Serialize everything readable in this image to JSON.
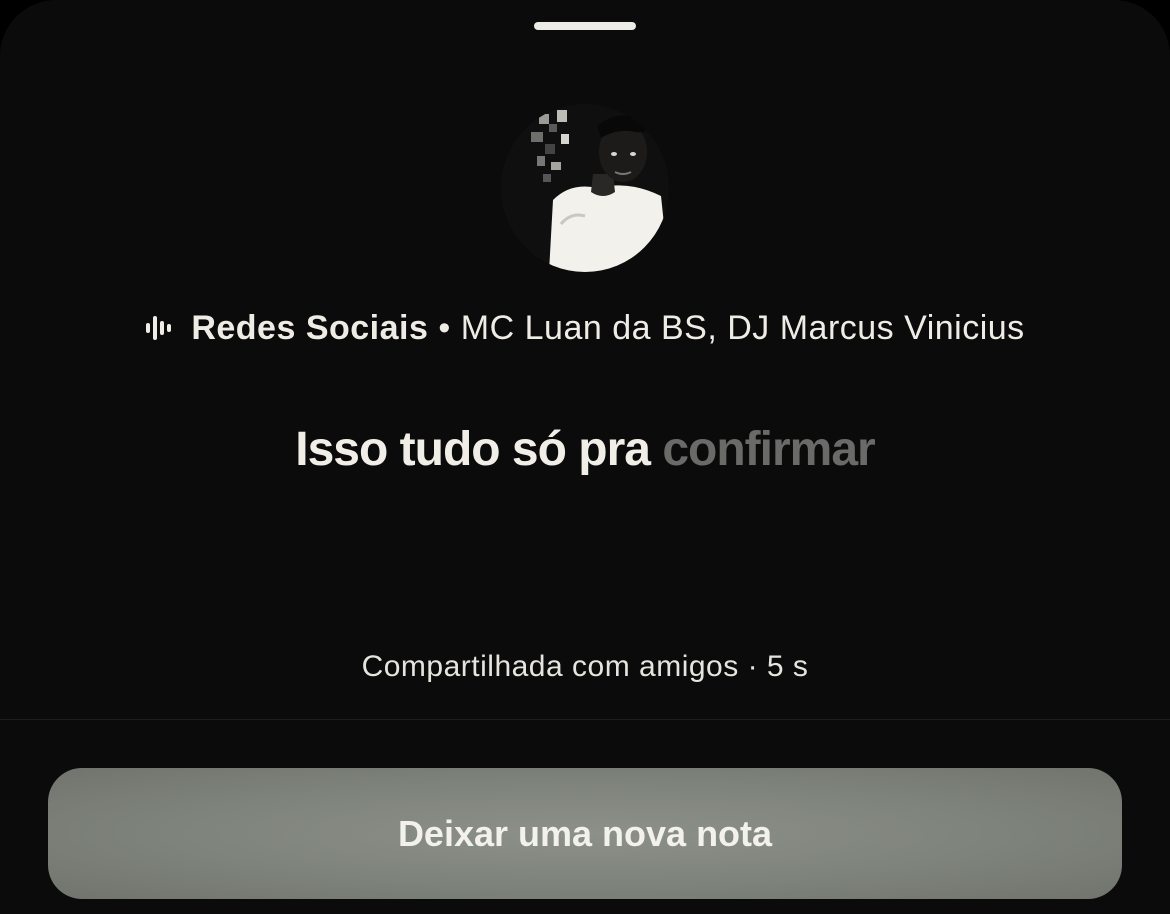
{
  "sheet": {
    "grabber_label": ""
  },
  "note": {
    "music_icon": "audio-wave-icon",
    "song_title": "Redes Sociais",
    "separator": "•",
    "artists": "MC Luan da BS, DJ Marcus Vinicius",
    "lyric_sung": "Isso tudo só pra",
    "lyric_upcoming": "confirmar",
    "meta": "Compartilhada com amigos · 5 s"
  },
  "actions": {
    "new_note_label": "Deixar uma nova nota"
  },
  "colors": {
    "background": "#0b0b0b",
    "text": "#efece6",
    "lyric_pending": "#6a6a68",
    "button": "#7e837c"
  }
}
